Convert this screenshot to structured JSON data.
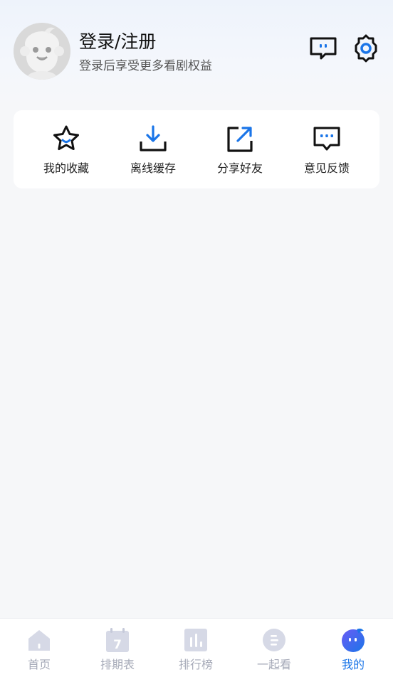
{
  "header": {
    "title": "登录/注册",
    "subtitle": "登录后享受更多看剧权益",
    "icons": [
      "avatar",
      "message-icon",
      "gear-icon"
    ]
  },
  "quick_actions": [
    {
      "label": "我的收藏",
      "icon": "star-icon"
    },
    {
      "label": "离线缓存",
      "icon": "download-icon"
    },
    {
      "label": "分享好友",
      "icon": "share-icon"
    },
    {
      "label": "意见反馈",
      "icon": "feedback-icon"
    }
  ],
  "tabbar": {
    "active_index": 4,
    "active_color": "#1a75e8",
    "inactive_color": "#a6aab8",
    "tabs": [
      {
        "label": "首页",
        "icon": "home-icon"
      },
      {
        "label": "排期表",
        "icon": "calendar-icon",
        "badge": "7"
      },
      {
        "label": "排行榜",
        "icon": "chart-icon"
      },
      {
        "label": "一起看",
        "icon": "watch-together-icon"
      },
      {
        "label": "我的",
        "icon": "mascot-icon"
      }
    ]
  }
}
